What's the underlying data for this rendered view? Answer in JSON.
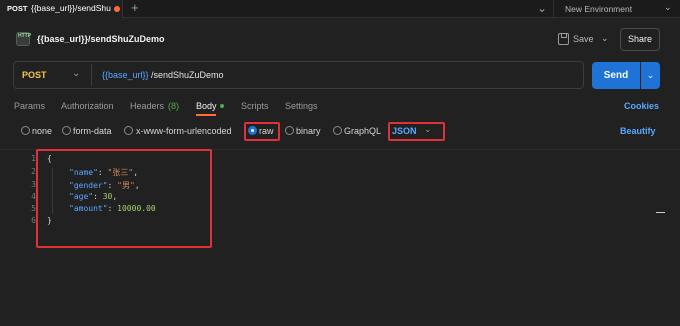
{
  "tab": {
    "method": "POST",
    "title": "{{base_url}}/sendShuZ",
    "new_tab_symbol": "+",
    "more_symbol": "⌄"
  },
  "environment": {
    "label": "New Environment"
  },
  "request": {
    "title": "{{base_url}}/sendShuZuDemo",
    "save_label": "Save",
    "share_label": "Share",
    "send_label": "Send",
    "method": "POST",
    "url_variable": "{{base_url}}",
    "url_path": "/sendShuZuDemo"
  },
  "request_tabs": {
    "params": "Params",
    "authorization": "Authorization",
    "headers": "Headers",
    "headers_count": "(8)",
    "body": "Body",
    "scripts": "Scripts",
    "settings": "Settings",
    "cookies": "Cookies"
  },
  "body_types": {
    "none": "none",
    "form_data": "form-data",
    "x_www": "x-www-form-urlencoded",
    "raw": "raw",
    "binary": "binary",
    "graphql": "GraphQL",
    "selected": "raw",
    "format": "JSON",
    "beautify": "Beautify"
  },
  "editor": {
    "line_numbers": [
      "1",
      "2",
      "3",
      "4",
      "5",
      "6"
    ],
    "open_brace": "{",
    "close_brace": "}",
    "colon": ": ",
    "comma": ",",
    "fields": [
      {
        "key": "\"name\"",
        "value": "\"张三\"",
        "type": "string"
      },
      {
        "key": "\"gender\"",
        "value": "\"男\"",
        "type": "string"
      },
      {
        "key": "\"age\"",
        "value": "30",
        "type": "number"
      },
      {
        "key": "\"amount\"",
        "value": "10000.00",
        "type": "number"
      }
    ]
  },
  "colors": {
    "accent": "#1f72d6",
    "highlight": "#e0303a",
    "method": "#f2c94c",
    "link": "#5aa8ff",
    "unsaved_dot": "#ff6c37"
  }
}
